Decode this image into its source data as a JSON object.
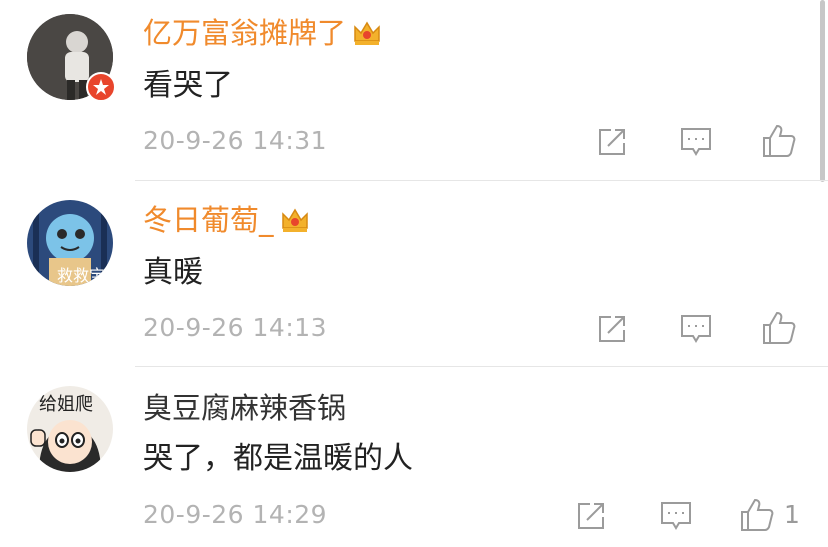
{
  "comments": [
    {
      "username": "亿万富翁摊牌了",
      "text": "看哭了",
      "time": "20-9-26 14:31",
      "like_count": "",
      "vip": true
    },
    {
      "username": "冬日葡萄_",
      "text": "真暖",
      "time": "20-9-26 14:13",
      "like_count": "",
      "vip": true,
      "avatar_text": "救救宝"
    },
    {
      "username": "臭豆腐麻辣香锅",
      "text": "哭了，都是温暖的人",
      "time": "20-9-26 14:29",
      "like_count": "1",
      "vip": false,
      "avatar_text": "给姐爬"
    }
  ],
  "colors": {
    "vip_name": "#f08a2c",
    "plain_name": "#333333",
    "time": "#b3b3b3",
    "verified_badge": "#e8452c"
  },
  "icons": [
    "share-icon",
    "reply-icon",
    "like-icon",
    "crown-vip-icon",
    "verified-badge-icon"
  ]
}
